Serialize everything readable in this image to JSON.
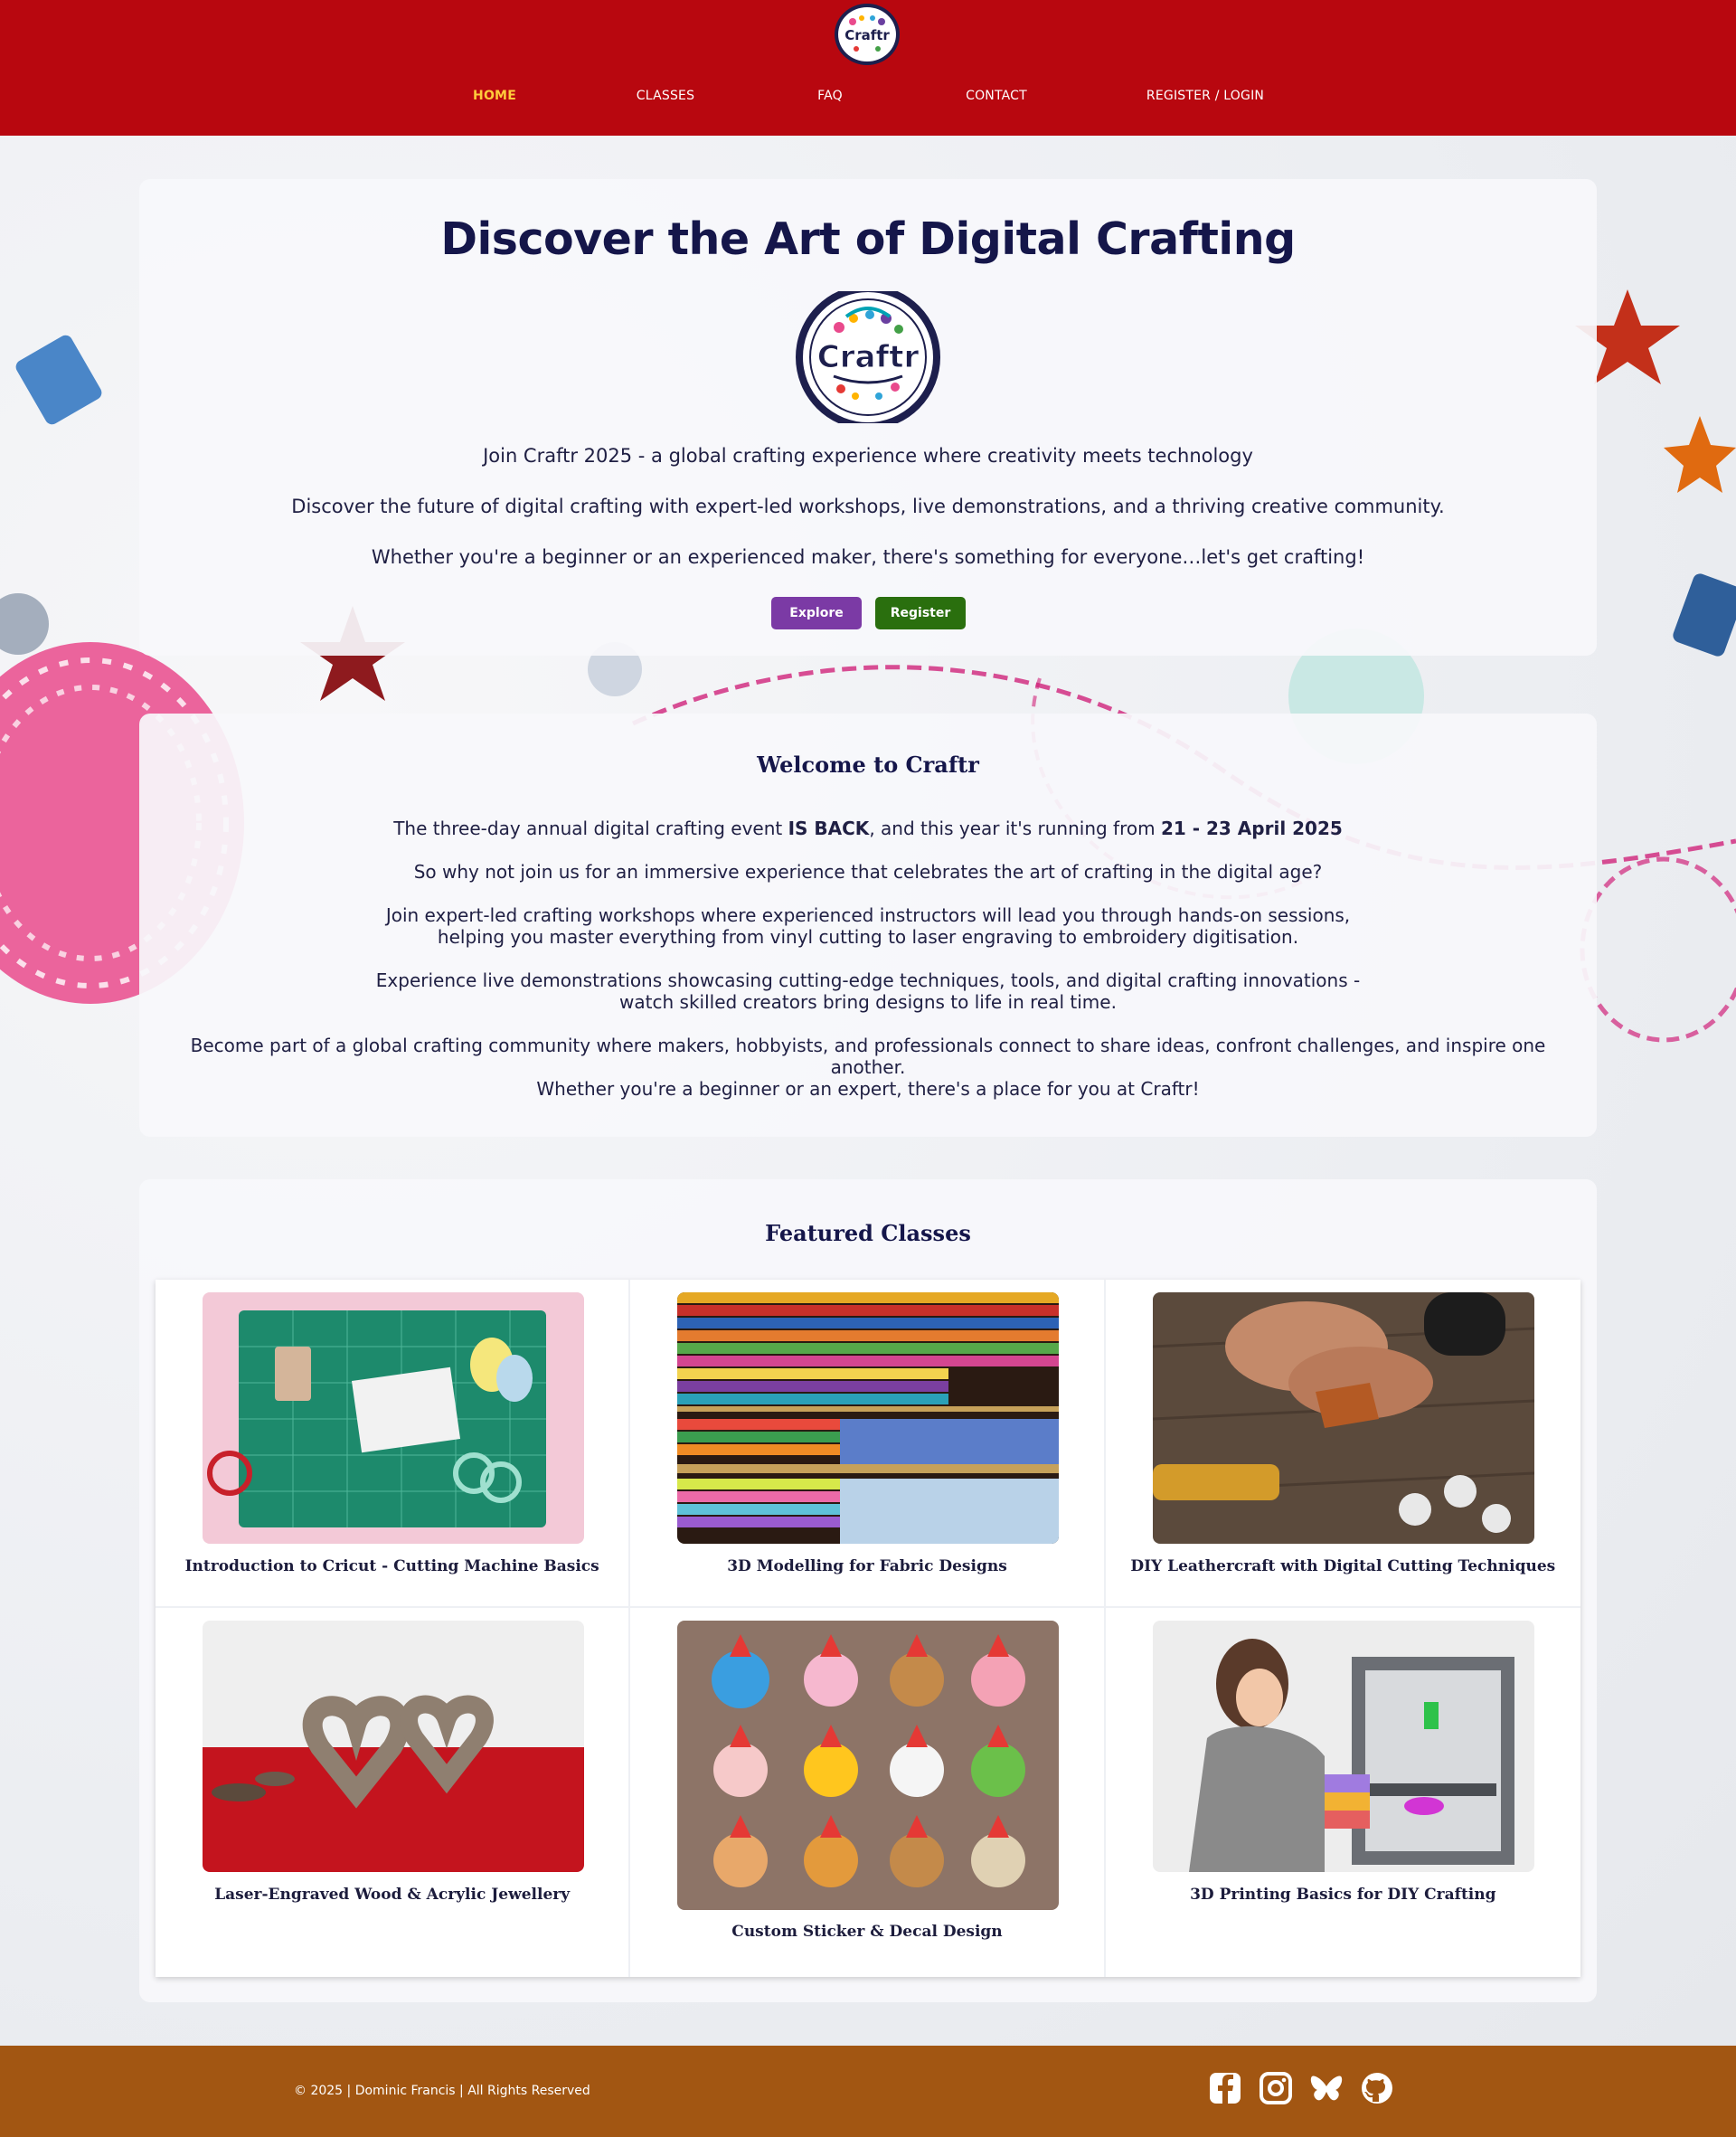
{
  "header": {
    "logo_text": "Craftr",
    "nav": [
      {
        "label": "HOME",
        "active": true
      },
      {
        "label": "CLASSES",
        "active": false
      },
      {
        "label": "FAQ",
        "active": false
      },
      {
        "label": "CONTACT",
        "active": false
      },
      {
        "label": "REGISTER / LOGIN",
        "active": false
      }
    ]
  },
  "hero": {
    "title": "Discover the Art of Digital Crafting",
    "logo_text": "Craftr",
    "line1": "Join Craftr 2025 - a global crafting experience where creativity meets technology",
    "line2": "Discover the future of digital crafting with expert-led workshops, live demonstrations, and a thriving creative community.",
    "line3": "Whether you're a beginner or an experienced maker, there's something for everyone…let's get crafting!",
    "explore_label": "Explore",
    "register_label": "Register"
  },
  "welcome": {
    "title": "Welcome to Craftr",
    "p1_a": "The three-day annual digital crafting event ",
    "p1_b": "IS BACK",
    "p1_c": ", and this year it's running from ",
    "p1_d": "21 - 23 April 2025",
    "p2": "So why not join us for an immersive experience that celebrates the art of crafting in the digital age?",
    "p3_l1": "Join expert-led crafting workshops where experienced instructors will lead you through hands-on sessions,",
    "p3_l2": "helping you master everything from vinyl cutting to laser engraving to embroidery digitisation.",
    "p4_l1": "Experience live demonstrations showcasing cutting-edge techniques, tools, and digital crafting innovations -",
    "p4_l2": "watch skilled creators bring designs to life in real time.",
    "p5_l1": "Become part of a global crafting community where makers, hobbyists, and professionals connect to share ideas, confront challenges, and inspire one",
    "p5_l2": "another.",
    "p6": "Whether you're a beginner or an expert, there's a place for you at Craftr!"
  },
  "featured": {
    "title": "Featured Classes",
    "classes": [
      {
        "label": "Introduction to Cricut - Cutting Machine Basics"
      },
      {
        "label": "3D Modelling for Fabric Designs"
      },
      {
        "label": "DIY Leathercraft with Digital Cutting Techniques"
      },
      {
        "label": "Laser-Engraved Wood & Acrylic Jewellery"
      },
      {
        "label": "Custom Sticker & Decal Design"
      },
      {
        "label": "3D Printing Basics for DIY Crafting"
      }
    ]
  },
  "footer": {
    "copyright": "© 2025 | Dominic Francis | All Rights Reserved",
    "socials": [
      "facebook-icon",
      "instagram-icon",
      "bluesky-icon",
      "github-icon"
    ]
  },
  "colors": {
    "header_bg": "#b8070f",
    "nav_active": "#ffcb3b",
    "title_navy": "#15164a",
    "explore_purple": "#7b3aa5",
    "register_green": "#2a6f0e",
    "footer_bg": "#a25612"
  }
}
